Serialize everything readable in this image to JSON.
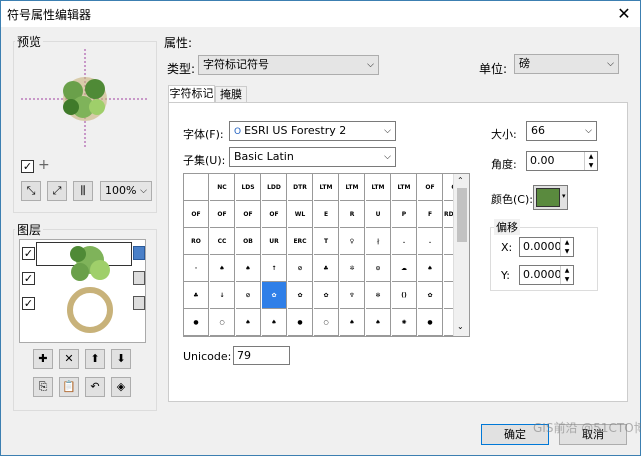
{
  "window": {
    "title": "符号属性编辑器",
    "close": "✕"
  },
  "preview": {
    "group_label": "预览",
    "add_symbol": "+",
    "zoom": "100%"
  },
  "layers": {
    "group_label": "图层"
  },
  "properties": {
    "group_label": "属性:",
    "type_label": "类型:",
    "type_value": "字符标记符号",
    "unit_label": "单位:",
    "unit_value": "磅",
    "tabs": [
      "字符标记",
      "掩膜"
    ],
    "font_label": "字体(F):",
    "font_value": "ESRI US Forestry 2",
    "font_icon": "O",
    "subset_label": "子集(U):",
    "subset_value": "Basic Latin",
    "size_label": "大小:",
    "size_value": "66",
    "angle_label": "角度:",
    "angle_value": "0.00",
    "color_label": "颜色(C):",
    "color_hex": "#5a8a3e",
    "offset_label": "偏移",
    "x_label": "X:",
    "x_value": "0.0000",
    "y_label": "Y:",
    "y_value": "0.0000",
    "unicode_label": "Unicode:",
    "unicode_value": "79"
  },
  "glyph_grid": {
    "rows": [
      [
        "",
        "NC",
        "LDS",
        "LDD",
        "DTR",
        "LTM",
        "LTM",
        "LTM",
        "LTM",
        "OF",
        "OF"
      ],
      [
        "OF",
        "OF",
        "OF",
        "OF",
        "WL",
        "E",
        "R",
        "U",
        "P",
        "F",
        "RD.NO."
      ],
      [
        "RO",
        "CC",
        "OB",
        "UR",
        "ERC",
        "T",
        "♀",
        "∤",
        ".",
        ".",
        "♣"
      ],
      [
        "·",
        "♠",
        "♠",
        "↑",
        "⊘",
        "♣",
        "✲",
        "⊙",
        "☁",
        "♠",
        "♠"
      ],
      [
        "♣",
        "↓",
        "⊘",
        "✿",
        "✿",
        "✿",
        "♆",
        "✻",
        "()",
        "✿",
        "✿"
      ],
      [
        "●",
        "○",
        "♠",
        "♠",
        "●",
        "○",
        "♠",
        "♠",
        "✺",
        "●",
        "💧"
      ]
    ],
    "selected_index": 47
  },
  "buttons": {
    "ok": "确定",
    "cancel": "取消"
  },
  "watermark": "GIS前沿 @51CTO博客"
}
